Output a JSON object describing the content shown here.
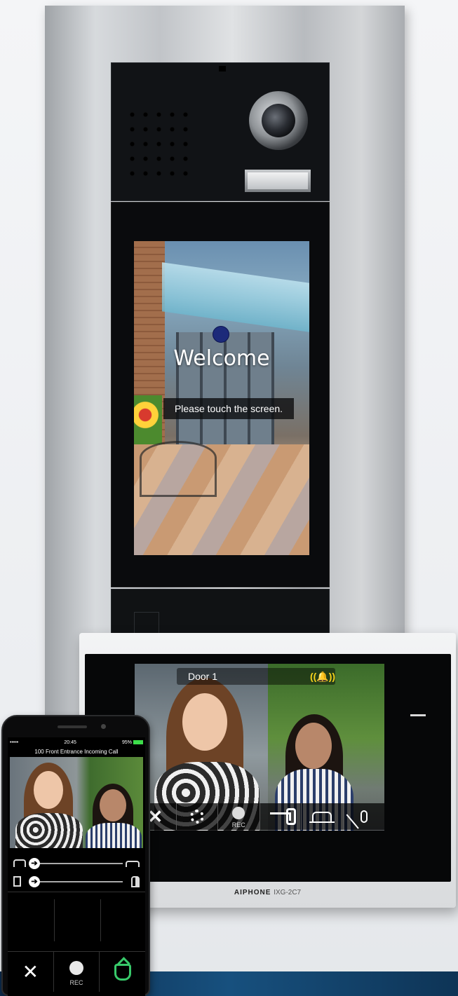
{
  "door_station": {
    "welcome": "Welcome",
    "prompt": "Please touch the screen."
  },
  "indoor_monitor": {
    "door_label": "Door 1",
    "toolbar": [
      {
        "icon": "close-icon"
      },
      {
        "icon": "gear-icon"
      },
      {
        "icon": "record-icon",
        "label": "REC"
      },
      {
        "icon": "door-release-key-icon"
      },
      {
        "icon": "option-icon"
      },
      {
        "icon": "mic-mute-icon"
      }
    ],
    "brand": "AIPHONE",
    "model": "IXG-2C7",
    "accent_color": "#f4d21a"
  },
  "smartphone": {
    "status": {
      "signal": "•••••",
      "time": "20:45",
      "right": "95%"
    },
    "call_title": "100 Front Entrance Incoming Call",
    "actions": [
      {
        "icon": "hang-up-icon"
      },
      {
        "icon": "record-icon",
        "label": "REC"
      },
      {
        "icon": "answer-icon",
        "color": "#38c96a"
      }
    ]
  }
}
